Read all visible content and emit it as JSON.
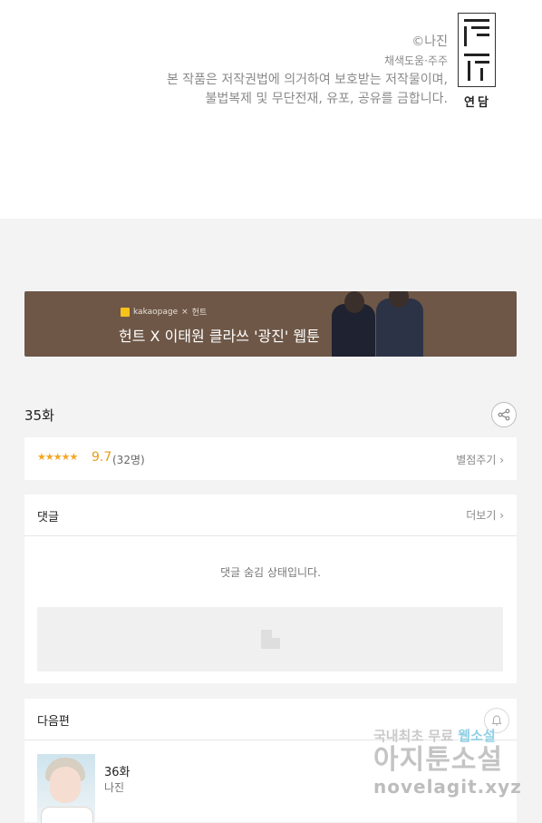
{
  "credits": {
    "author": "©나진",
    "assist": "채색도움·주주",
    "notice_line1": "본 작품은 저작권법에 의거하여 보호받는 저작물이며,",
    "notice_line2": "불법복제 및 무단전재, 유포, 공유를 금합니다.",
    "studio": "연담"
  },
  "banner": {
    "top_brand": "kakaopage",
    "top_x": "×",
    "top_partner": "헌트",
    "title": "헌트 X 이태원 클라쓰 '광진' 웹툰"
  },
  "episode": {
    "title": "35화"
  },
  "rating": {
    "stars": "★★★★★",
    "score": "9.7",
    "count": "(32명)",
    "rate_link": "별점주기 ›"
  },
  "comments": {
    "title": "댓글",
    "more": "더보기 ›",
    "hidden_message": "댓글 숨김 상태입니다."
  },
  "next": {
    "title": "다음편",
    "episode": "36화",
    "author": "나진"
  },
  "watermark": {
    "line1_a": "국내최초 무료",
    "line1_b": "웹소설",
    "line2": "아지툰소설",
    "line3": "novelagit.xyz"
  }
}
